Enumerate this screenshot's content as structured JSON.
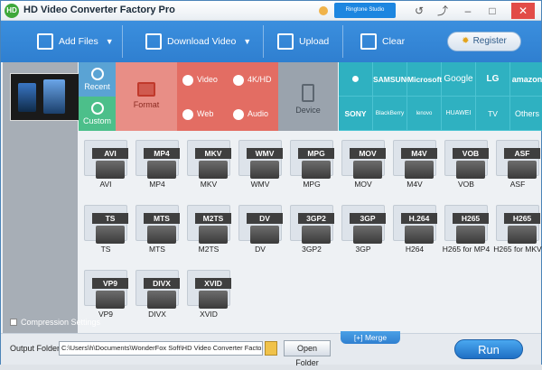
{
  "app": {
    "title": "HD Video Converter Factory Pro",
    "icon_text": "HD"
  },
  "titlebar": {
    "promo": "Ringtone Studio",
    "buttons": [
      "↺",
      "⤴",
      "–",
      "□",
      "✕"
    ]
  },
  "toolbar": {
    "add_files": "Add Files",
    "download_video": "Download Video",
    "upload": "Upload",
    "clear": "Clear",
    "register": "Register"
  },
  "categories": {
    "recent": "Recent",
    "custom": "Custom",
    "format": "Format",
    "video": "Video",
    "fourk": "4K/HD",
    "web": "Web",
    "audio": "Audio",
    "device": "Device"
  },
  "brands": {
    "row1": [
      "",
      "SAMSUNG",
      "Microsoft",
      "Google",
      "LG",
      "amazon"
    ],
    "row2": [
      "SONY",
      "BlackBerry",
      "lenovo MOTOROLA",
      "HUAWEI",
      "TV",
      "Others"
    ]
  },
  "formats": [
    {
      "tag": "AVI",
      "label": "AVI"
    },
    {
      "tag": "MP4",
      "label": "MP4"
    },
    {
      "tag": "MKV",
      "label": "MKV"
    },
    {
      "tag": "WMV",
      "label": "WMV"
    },
    {
      "tag": "MPG",
      "label": "MPG"
    },
    {
      "tag": "MOV",
      "label": "MOV"
    },
    {
      "tag": "M4V",
      "label": "M4V"
    },
    {
      "tag": "VOB",
      "label": "VOB"
    },
    {
      "tag": "ASF",
      "label": "ASF"
    },
    {
      "tag": "TS",
      "label": "TS"
    },
    {
      "tag": "MTS",
      "label": "MTS"
    },
    {
      "tag": "M2TS",
      "label": "M2TS"
    },
    {
      "tag": "DV",
      "label": "DV"
    },
    {
      "tag": "3GP2",
      "label": "3GP2"
    },
    {
      "tag": "3GP",
      "label": "3GP"
    },
    {
      "tag": "H.264",
      "label": "H264"
    },
    {
      "tag": "H265",
      "label": "H265 for MP4"
    },
    {
      "tag": "H265",
      "label": "H265 for MKV"
    },
    {
      "tag": "VP9",
      "label": "VP9"
    },
    {
      "tag": "DIVX",
      "label": "DIVX"
    },
    {
      "tag": "XVID",
      "label": "XVID"
    }
  ],
  "footer": {
    "compression": "Compression Settings",
    "output_label": "Output Folder:",
    "output_path": "C:\\Users\\h\\Documents\\WonderFox Soft\\HD Video Converter Factory Pro\\Ou",
    "open_folder": "Open Folder",
    "merge": "[+] Merge",
    "run": "Run"
  },
  "colors": {
    "toolbar": "#2f7fd0",
    "format_panel": "#e88e86",
    "video_panel": "#e36d63",
    "device_panel": "#9aa3ad",
    "brand_panel": "#2fb1c1",
    "recent": "#5aa3d4",
    "custom": "#4cbf8a"
  }
}
